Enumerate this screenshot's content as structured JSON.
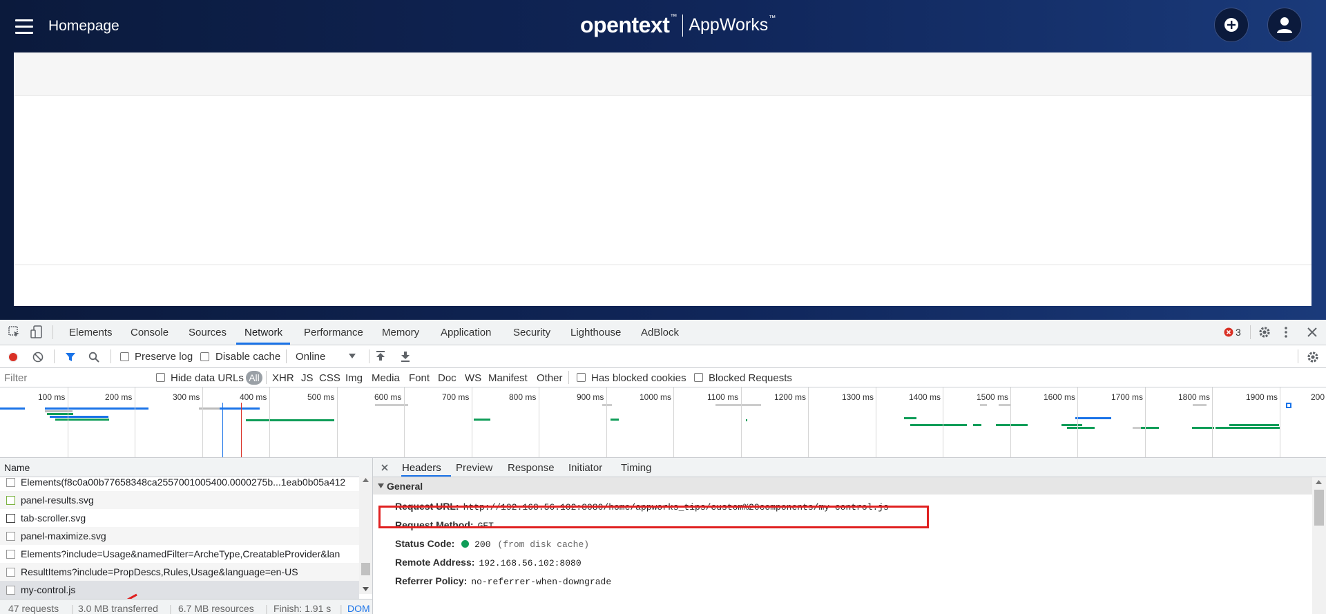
{
  "app": {
    "title": "Homepage",
    "brand": {
      "name": "opentext",
      "mark": "™",
      "product": "AppWorks",
      "product_mark": "™"
    },
    "colors": {
      "header_start": "#0b1a3c",
      "header_end": "#1a3a7a"
    }
  },
  "devtools": {
    "tabs": [
      "Elements",
      "Console",
      "Sources",
      "Network",
      "Performance",
      "Memory",
      "Application",
      "Security",
      "Lighthouse",
      "AdBlock"
    ],
    "active_tab": "Network",
    "error_count": "3",
    "toolbar": {
      "preserve_log": "Preserve log",
      "disable_cache": "Disable cache",
      "throttle": "Online"
    },
    "filterbar": {
      "filter_placeholder": "Filter",
      "hide_data_urls": "Hide data URLs",
      "types": [
        "All",
        "XHR",
        "JS",
        "CSS",
        "Img",
        "Media",
        "Font",
        "Doc",
        "WS",
        "Manifest",
        "Other"
      ],
      "has_blocked_cookies": "Has blocked cookies",
      "blocked_requests": "Blocked Requests"
    },
    "overview_ticks": [
      "100 ms",
      "200 ms",
      "300 ms",
      "400 ms",
      "500 ms",
      "600 ms",
      "700 ms",
      "800 ms",
      "900 ms",
      "1000 ms",
      "1100 ms",
      "1200 ms",
      "1300 ms",
      "1400 ms",
      "1500 ms",
      "1600 ms",
      "1700 ms",
      "1800 ms",
      "1900 ms",
      "200"
    ],
    "requests": {
      "column_name": "Name",
      "rows": [
        "Elements(f8c0a00b77658348ca2557001005400.0000275b...1eab0b05a412",
        "panel-results.svg",
        "tab-scroller.svg",
        "panel-maximize.svg",
        "Elements?include=Usage&namedFilter=ArcheType,CreatableProvider&lan",
        "ResultItems?include=PropDescs,Rules,Usage&language=en-US",
        "my-control.js"
      ],
      "status": {
        "requests": "47 requests",
        "transferred": "3.0 MB transferred",
        "resources": "6.7 MB resources",
        "finish": "Finish: 1.91 s",
        "dom": "DOM"
      }
    },
    "detail": {
      "tabs": [
        "Headers",
        "Preview",
        "Response",
        "Initiator",
        "Timing"
      ],
      "active_tab": "Headers",
      "section": "General",
      "headers": {
        "request_url_label": "Request URL:",
        "request_url": "http://192.168.56.102:8080/home/appworks_tips/custom%20components/my-control.js",
        "method_label": "Request Method:",
        "method": "GET",
        "status_label": "Status Code:",
        "status": "200",
        "status_note": "(from disk cache)",
        "remote_label": "Remote Address:",
        "remote": "192.168.56.102:8080",
        "referrer_label": "Referrer Policy:",
        "referrer": "no-referrer-when-downgrade"
      }
    }
  }
}
